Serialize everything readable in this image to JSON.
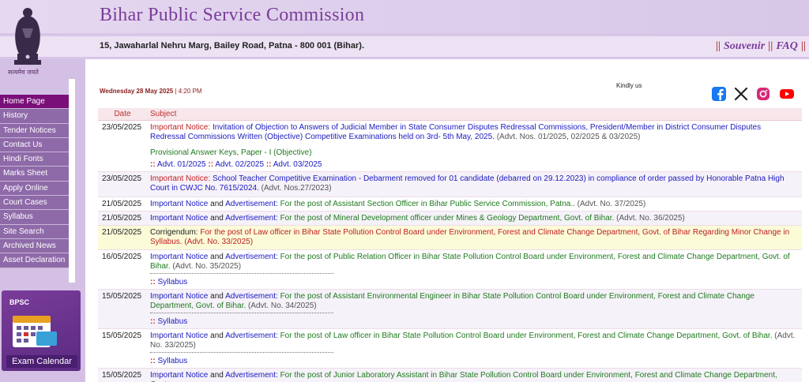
{
  "header": {
    "title": "Bihar Public Service Commission",
    "address": "15, Jawaharlal Nehru Marg, Bailey Road, Patna - 800 001 (Bihar).",
    "links": [
      {
        "label": "Souvenir"
      },
      {
        "label": "FAQ"
      }
    ],
    "emblem_text": "सत्यमेव जयते"
  },
  "sidebar": {
    "items": [
      {
        "label": "Home Page",
        "active": true
      },
      {
        "label": "History"
      },
      {
        "label": "Tender Notices"
      },
      {
        "label": "Contact Us"
      },
      {
        "label": "Hindi Fonts"
      },
      {
        "label": "Marks Sheet"
      },
      {
        "label": "Apply Online"
      },
      {
        "label": "Court Cases"
      },
      {
        "label": "Syllabus"
      },
      {
        "label": "Site Search"
      },
      {
        "label": "Archived News"
      },
      {
        "label": "Asset Declaration"
      }
    ],
    "calendar": {
      "brand": "BPSC",
      "year": "2024-25",
      "label": "Exam Calendar"
    }
  },
  "datebar": {
    "date": "Wednesday 28 May 2025",
    "separator": " | ",
    "time": "4:20 PM"
  },
  "social": {
    "label": "Kindly us",
    "icons": [
      "facebook-icon",
      "x-icon",
      "instagram-icon",
      "youtube-icon"
    ]
  },
  "table": {
    "headers": {
      "date": "Date",
      "subject": "Subject"
    },
    "rows": [
      {
        "date": "23/05/2025",
        "label": "Important Notice:",
        "text": "Invitation of Objection to Answers of Judicial Member in State Consumer Disputes Redressal Commissions, President/Member in District Consumer Disputes Redressal Commissions Written (Objective) Competitive Examinations held on 3rd- 5th May, 2025.",
        "advt": "(Advt. Nos. 01/2025, 02/2025 & 03/2025)",
        "sub": "Provisional Answer Keys, Paper - I (Objective)",
        "links": [
          "Advt. 01/2025",
          "Advt. 02/2025",
          "Advt. 03/2025"
        ]
      },
      {
        "date": "23/05/2025",
        "label": "Important Notice:",
        "text": "School Teacher Competitive Examination - Debarment removed for 01 candidate (debarred on 29.12.2023) in compliance of order passed by Honorable Patna High Court in CWJC No. 7615/2024.",
        "advt": "(Advt. Nos.27/2023)"
      },
      {
        "date": "21/05/2025",
        "label": "Important Notice",
        "conj": "and",
        "label2": "Advertisement:",
        "text": "For the post of Assistant Section Officer in Bihar Public Service Commission, Patna..",
        "advt": "(Advt. No. 37/2025)"
      },
      {
        "date": "21/05/2025",
        "label": "Important Notice",
        "conj": "and",
        "label2": "Advertisement:",
        "text": "For the post of Mineral Development officer under Mines & Geology Department, Govt. of Bihar.",
        "advt": "(Advt. No. 36/2025)"
      },
      {
        "date": "21/05/2025",
        "label": "Corrigendum:",
        "text": "For the post of Law officer in Bihar State Pollution Control Board under Environment, Forest and Climate Change Department, Govt. of Bihar Regarding Minor Change in Syllabus. (Advt. No. 33/2025)"
      },
      {
        "date": "16/05/2025",
        "label": "Important Notice",
        "conj": "and",
        "label2": "Advertisement:",
        "text": "For the post of Public Relation Officer in Bihar State Pollution Control Board under Environment, Forest and Climate Change Department, Govt. of Bihar.",
        "advt": "(Advt. No. 35/2025)",
        "link": "Syllabus"
      },
      {
        "date": "15/05/2025",
        "label": "Important Notice",
        "conj": "and",
        "label2": "Advertisement:",
        "text": "For the post of Assistant Environmental Engineer in Bihar State Pollution Control Board under Environment, Forest and Climate Change Department, Govt. of Bihar.",
        "advt": "(Advt. No. 34/2025)",
        "link": "Syllabus"
      },
      {
        "date": "15/05/2025",
        "label": "Important Notice",
        "conj": "and",
        "label2": "Advertisement:",
        "text": "For the post of Law officer in Bihar State Pollution Control Board under Environment, Forest and Climate Change Department, Govt. of Bihar.",
        "advt": "(Advt. No. 33/2025)",
        "link": "Syllabus"
      },
      {
        "date": "15/05/2025",
        "label": "Important Notice",
        "conj": "and",
        "label2": "Advertisement:",
        "text": "For the post of Junior Laboratory Assistant in Bihar State Pollution Control Board under Environment, Forest and Climate Change Department, Govt."
      }
    ]
  },
  "colors": {
    "brand_purple": "#7a3d9a",
    "nav_bg": "#8e6aa8",
    "nav_active": "#7a0f7a",
    "notice_red": "#c02020",
    "link_blue": "#1a1ac0",
    "text_green": "#1e7a1e"
  }
}
